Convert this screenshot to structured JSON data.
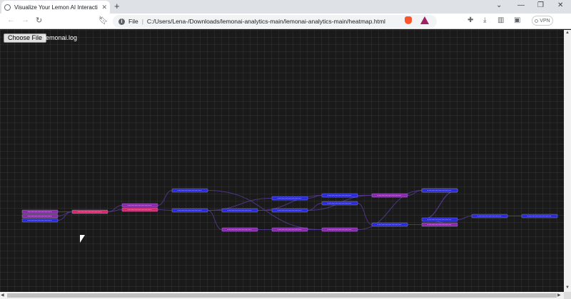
{
  "browser": {
    "tab_title": "Visualize Your Lemon AI Interacti",
    "tab_close": "✕",
    "new_tab": "+",
    "url_scheme": "File",
    "url": "C:/Users/Lena-/Downloads/lemonai-analytics-main/lemonai-analytics-main/heatmap.html",
    "vpn_label": "VPN",
    "minimize": "⌄",
    "restore": "—",
    "maximize": "❐",
    "close": "✕"
  },
  "page": {
    "choose_file_label": "Choose File",
    "file_name": "lemonai.log"
  },
  "colors": {
    "node_blue": "#2a2ad8",
    "node_purple": "#8a2aa8",
    "node_pink": "#d42a6a",
    "edge": "#5a3aa0"
  },
  "graph": {
    "nodes": [
      {
        "id": "n1",
        "color": "purple"
      },
      {
        "id": "n2",
        "color": "purple"
      },
      {
        "id": "n3",
        "color": "blue"
      },
      {
        "id": "n4",
        "color": "pink"
      },
      {
        "id": "n5",
        "color": "purple"
      },
      {
        "id": "n6",
        "color": "pink"
      },
      {
        "id": "n7",
        "color": "blue"
      },
      {
        "id": "n8",
        "color": "blue"
      },
      {
        "id": "n9",
        "color": "blue"
      },
      {
        "id": "n10",
        "color": "purple"
      },
      {
        "id": "n11",
        "color": "blue"
      },
      {
        "id": "n12",
        "color": "blue"
      },
      {
        "id": "n13",
        "color": "purple"
      },
      {
        "id": "n14",
        "color": "blue"
      },
      {
        "id": "n15",
        "color": "blue"
      },
      {
        "id": "n16",
        "color": "purple"
      },
      {
        "id": "n17",
        "color": "purple"
      },
      {
        "id": "n18",
        "color": "blue"
      },
      {
        "id": "n19",
        "color": "purple"
      },
      {
        "id": "n20",
        "color": "blue"
      },
      {
        "id": "n21",
        "color": "purple"
      },
      {
        "id": "n22",
        "color": "blue"
      },
      {
        "id": "n23",
        "color": "blue"
      },
      {
        "id": "n24",
        "color": "blue"
      }
    ],
    "edges": [
      [
        "n1",
        "n4"
      ],
      [
        "n2",
        "n4"
      ],
      [
        "n3",
        "n4"
      ],
      [
        "n4",
        "n5"
      ],
      [
        "n4",
        "n6"
      ],
      [
        "n6",
        "n8"
      ],
      [
        "n5",
        "n7"
      ],
      [
        "n8",
        "n9"
      ],
      [
        "n8",
        "n10"
      ],
      [
        "n8",
        "n11"
      ],
      [
        "n9",
        "n12"
      ],
      [
        "n11",
        "n14"
      ],
      [
        "n10",
        "n13"
      ],
      [
        "n12",
        "n15"
      ],
      [
        "n13",
        "n16"
      ],
      [
        "n14",
        "n17"
      ],
      [
        "n15",
        "n18"
      ],
      [
        "n16",
        "n19"
      ],
      [
        "n17",
        "n20"
      ],
      [
        "n18",
        "n21"
      ],
      [
        "n20",
        "n22"
      ],
      [
        "n21",
        "n22"
      ],
      [
        "n22",
        "n23"
      ],
      [
        "n23",
        "n24"
      ],
      [
        "n19",
        "n22"
      ],
      [
        "n9",
        "n14"
      ],
      [
        "n7",
        "n16"
      ],
      [
        "n12",
        "n17"
      ]
    ]
  }
}
